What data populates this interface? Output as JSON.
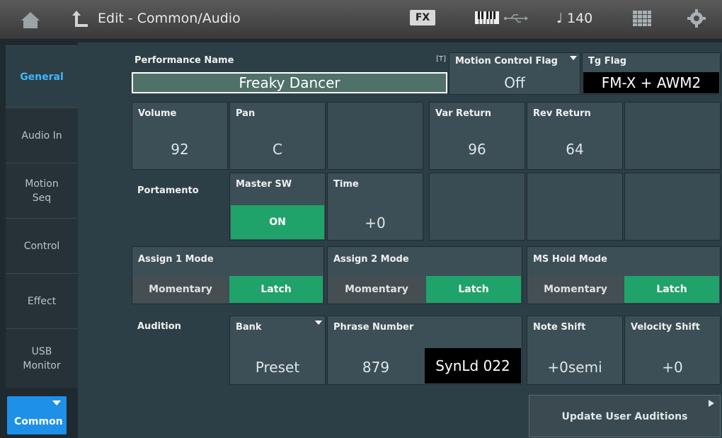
{
  "header": {
    "title": "Edit - Common/Audio",
    "fx_label": "FX",
    "tempo": "♩ 140",
    "icons": [
      "home-icon",
      "back-icon",
      "keyboard-icon",
      "usb-icon",
      "grid-icon",
      "gear-icon"
    ]
  },
  "sidebar": {
    "items": [
      {
        "label": "General",
        "active": true
      },
      {
        "label": "Audio In"
      },
      {
        "label": "Motion Seq"
      },
      {
        "label": "Control"
      },
      {
        "label": "Effect"
      },
      {
        "label": "USB Monitor"
      }
    ],
    "common_label": "Common"
  },
  "performance": {
    "name_label": "Performance Name",
    "name_value": "Freaky Dancer",
    "text_icon": "[T]",
    "motion_flag_label": "Motion Control Flag",
    "motion_flag_value": "Off",
    "tg_flag_label": "Tg Flag",
    "tg_flag_value": "FM-X + AWM2"
  },
  "levels": {
    "volume_label": "Volume",
    "volume_value": "92",
    "pan_label": "Pan",
    "pan_value": "C",
    "var_return_label": "Var Return",
    "var_return_value": "96",
    "rev_return_label": "Rev Return",
    "rev_return_value": "64"
  },
  "portamento": {
    "label": "Portamento",
    "master_sw_label": "Master SW",
    "master_sw_value": "ON",
    "time_label": "Time",
    "time_value": "+0"
  },
  "assign": {
    "assign1_label": "Assign 1 Mode",
    "assign2_label": "Assign 2 Mode",
    "ms_hold_label": "MS Hold Mode",
    "momentary": "Momentary",
    "latch": "Latch"
  },
  "audition": {
    "label": "Audition",
    "bank_label": "Bank",
    "bank_value": "Preset",
    "phrase_label": "Phrase Number",
    "phrase_value": "879",
    "phrase_name": "SynLd 022",
    "note_shift_label": "Note Shift",
    "note_shift_value": "+0semi",
    "velocity_shift_label": "Velocity Shift",
    "velocity_shift_value": "+0"
  },
  "update_button": "Update User Auditions",
  "colors": {
    "accent_green": "#20a36a",
    "accent_blue": "#1e90e8"
  }
}
